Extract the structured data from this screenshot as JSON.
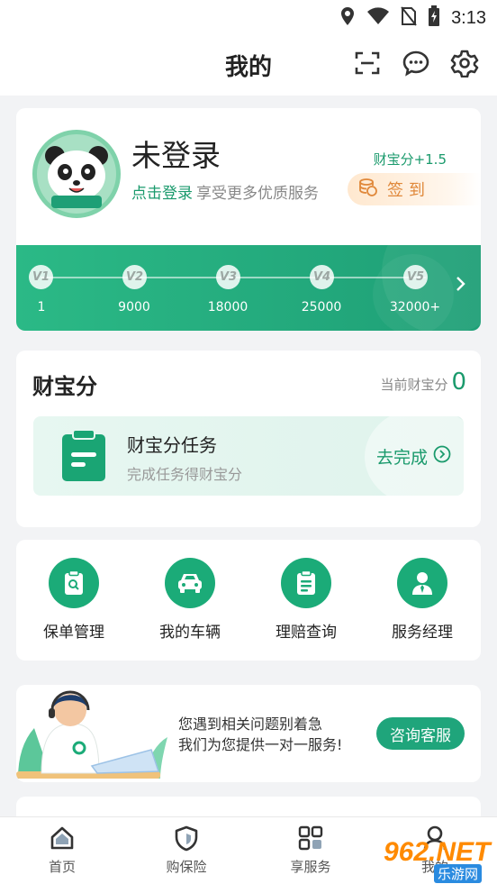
{
  "status_bar": {
    "time": "3:13"
  },
  "header": {
    "title": "我的"
  },
  "profile": {
    "name": "未登录",
    "login_link": "点击登录",
    "login_tip": "享受更多优质服务",
    "score_plus": "财宝分+1.5",
    "signin_label": "签到",
    "levels": [
      {
        "badge": "V1",
        "value": "1"
      },
      {
        "badge": "V2",
        "value": "9000"
      },
      {
        "badge": "V3",
        "value": "18000"
      },
      {
        "badge": "V4",
        "value": "25000"
      },
      {
        "badge": "V5",
        "value": "32000+"
      }
    ]
  },
  "points": {
    "title": "财宝分",
    "current_label": "当前财宝分",
    "current_value": "0",
    "task": {
      "title": "财宝分任务",
      "subtitle": "完成任务得财宝分",
      "action": "去完成"
    }
  },
  "services": [
    {
      "label": "保单管理",
      "icon": "policy-search-icon"
    },
    {
      "label": "我的车辆",
      "icon": "car-icon"
    },
    {
      "label": "理赔查询",
      "icon": "clipboard-icon"
    },
    {
      "label": "服务经理",
      "icon": "manager-icon"
    }
  ],
  "consult": {
    "line1": "您遇到相关问题别着急",
    "line2": "我们为您提供一对一服务!",
    "button": "咨询客服"
  },
  "bottom_nav": [
    {
      "label": "首页",
      "icon": "home-icon"
    },
    {
      "label": "购保险",
      "icon": "shield-icon"
    },
    {
      "label": "享服务",
      "icon": "grid-icon"
    },
    {
      "label": "我的",
      "icon": "user-icon"
    }
  ],
  "watermark": {
    "text": "962.NET",
    "sub": "乐游网"
  },
  "colors": {
    "brand": "#1fa57b",
    "accent": "#e0883a"
  }
}
